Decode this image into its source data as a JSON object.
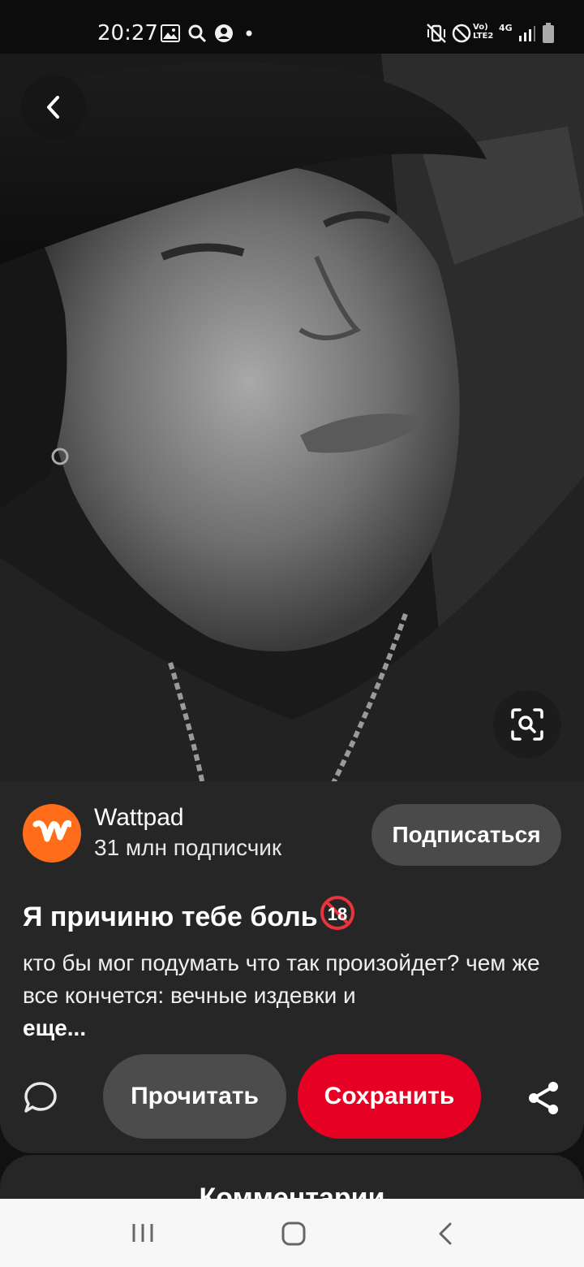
{
  "status_bar": {
    "time": "20:27",
    "left_icons": [
      "gallery-icon",
      "search-icon",
      "account-icon",
      "dot-icon"
    ],
    "right_icons": [
      "mute-vibrate-icon",
      "do-not-disturb-icon",
      "volte-icon",
      "4g-icon",
      "signal-icon",
      "battery-icon"
    ],
    "volte_label": "Vo) LTE2",
    "network_label": "4G"
  },
  "pin": {
    "title": "Я причиню тебе боль",
    "title_badge": "18",
    "description": "кто бы мог подумать что так произойдет? чем же все кончется: вечные издевки и",
    "more_label": "еще..."
  },
  "creator": {
    "name": "Wattpad",
    "followers": "31 млн подписчик",
    "avatar_letter": "W",
    "avatar_color": "#ff6d1a"
  },
  "actions": {
    "follow_label": "Подписаться",
    "read_label": "Прочитать",
    "save_label": "Сохранить",
    "save_color": "#e60023"
  },
  "comments": {
    "title": "Комментарии"
  },
  "nav_bar": {
    "buttons": [
      "recent-apps-icon",
      "home-icon",
      "back-icon"
    ]
  }
}
